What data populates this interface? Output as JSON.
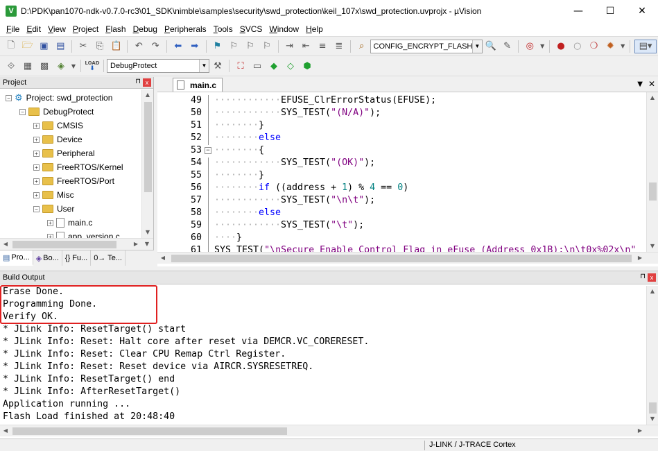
{
  "window": {
    "title": "D:\\PDK\\pan1070-ndk-v0.7.0-rc3\\01_SDK\\nimble\\samples\\security\\swd_protection\\keil_107x\\swd_protection.uvprojx - µVision",
    "app_icon_letter": "V",
    "minimize": "—",
    "maximize": "☐",
    "close": "✕"
  },
  "menu": {
    "items": [
      {
        "ul": "F",
        "rest": "ile"
      },
      {
        "ul": "E",
        "rest": "dit"
      },
      {
        "ul": "V",
        "rest": "iew"
      },
      {
        "ul": "P",
        "rest": "roject"
      },
      {
        "ul": "F",
        "rest": "lash"
      },
      {
        "ul": "D",
        "rest": "ebug"
      },
      {
        "ul": "P",
        "rest": "eripherals"
      },
      {
        "ul": "T",
        "rest": "ools"
      },
      {
        "ul": "S",
        "rest": "VCS"
      },
      {
        "ul": "W",
        "rest": "indow"
      },
      {
        "ul": "H",
        "rest": "elp"
      }
    ]
  },
  "toolbar1": {
    "config_combo": "CONFIG_ENCRYPT_FLASH"
  },
  "toolbar2": {
    "load_label": "LOAD",
    "target_combo": "DebugProtect"
  },
  "project_pane": {
    "header": "Project",
    "pin": "⊓",
    "close": "x",
    "tree": [
      {
        "label": "Project: swd_protection",
        "exp": "−",
        "icon": "project"
      },
      {
        "label": "DebugProtect",
        "exp": "−",
        "icon": "folder"
      },
      {
        "label": "CMSIS",
        "exp": "+",
        "icon": "folder"
      },
      {
        "label": "Device",
        "exp": "+",
        "icon": "folder"
      },
      {
        "label": "Peripheral",
        "exp": "+",
        "icon": "folder"
      },
      {
        "label": "FreeRTOS/Kernel",
        "exp": "+",
        "icon": "folder"
      },
      {
        "label": "FreeRTOS/Port",
        "exp": "+",
        "icon": "folder"
      },
      {
        "label": "Misc",
        "exp": "+",
        "icon": "folder"
      },
      {
        "label": "User",
        "exp": "−",
        "icon": "folder"
      },
      {
        "label": "main.c",
        "exp": "+",
        "icon": "file"
      },
      {
        "label": "app_version.c",
        "exp": "+",
        "icon": "file"
      }
    ],
    "tabs": [
      "Pro...",
      "Bo...",
      "{} Fu...",
      "0→ Te..."
    ]
  },
  "editor": {
    "tab": "main.c",
    "lines": [
      {
        "n": "49",
        "ind": 12,
        "html": "EFUSE_ClrErrorStatus(EFUSE);"
      },
      {
        "n": "50",
        "ind": 12,
        "html": "SYS_TEST(<span class=\"str\">\"(N/A)\"</span>);"
      },
      {
        "n": "51",
        "ind": 8,
        "html": "}"
      },
      {
        "n": "52",
        "ind": 8,
        "html": "<span class=\"kw\">else</span>"
      },
      {
        "n": "53",
        "ind": 8,
        "html": "{",
        "fold": "−"
      },
      {
        "n": "54",
        "ind": 12,
        "html": "SYS_TEST(<span class=\"str\">\"(OK)\"</span>);"
      },
      {
        "n": "55",
        "ind": 8,
        "html": "}"
      },
      {
        "n": "56",
        "ind": 8,
        "html": "<span class=\"kw\">if</span> ((address + <span class=\"num\">1</span>) % <span class=\"num\">4</span> == <span class=\"num\">0</span>)"
      },
      {
        "n": "57",
        "ind": 12,
        "html": "SYS_TEST(<span class=\"str\">\"\\n\\t\"</span>);"
      },
      {
        "n": "58",
        "ind": 8,
        "html": "<span class=\"kw\">else</span>"
      },
      {
        "n": "59",
        "ind": 12,
        "html": "SYS_TEST(<span class=\"str\">\"\\t\"</span>);"
      },
      {
        "n": "60",
        "ind": 4,
        "html": "}"
      },
      {
        "n": "61",
        "ind": 0,
        "html": "SYS_TEST(<span class=\"str\">\"\\nSecure Enable Control Flag in eFuse (Address 0x1B):\\n\\t0x%02x\\n\"</span>"
      }
    ]
  },
  "build_output": {
    "header": "Build Output",
    "pin": "⊓",
    "close": "x",
    "lines": [
      "Erase Done.",
      "Programming Done.",
      "Verify OK.",
      "* JLink Info: ResetTarget() start",
      "* JLink Info: Reset: Halt core after reset via DEMCR.VC_CORERESET.",
      "* JLink Info: Reset: Clear CPU Remap Ctrl Register.",
      "* JLink Info: Reset: Reset device via AIRCR.SYSRESETREQ.",
      "* JLink Info: ResetTarget() end",
      "* JLink Info: AfterResetTarget()",
      "Application running ...",
      "Flash Load finished at 20:48:40"
    ]
  },
  "status": {
    "debugger": "J-LINK / J-TRACE Cortex"
  },
  "colors": {
    "highlight": "#e02020",
    "keyword": "#0000ff",
    "string": "#800080",
    "number": "#008080"
  }
}
